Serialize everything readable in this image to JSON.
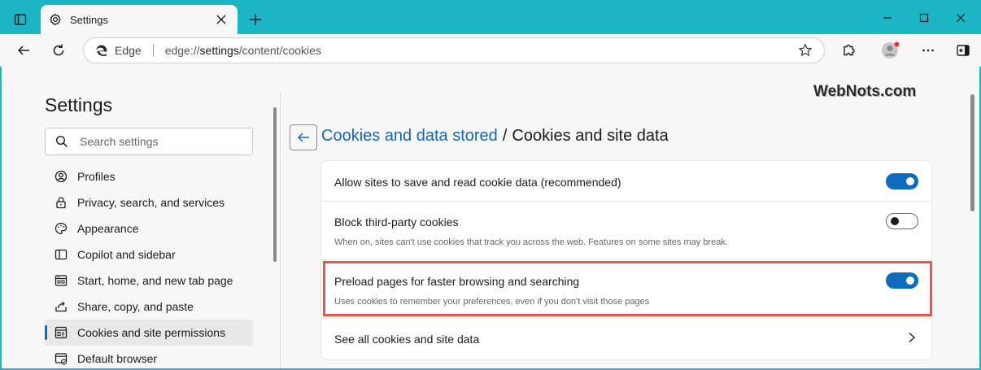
{
  "tab": {
    "title": "Settings"
  },
  "address": {
    "browser_label": "Edge",
    "url_prefix": "edge://",
    "url_bold": "settings",
    "url_suffix": "/content/cookies"
  },
  "watermark": "WebNots.com",
  "sidebar": {
    "title": "Settings",
    "search_placeholder": "Search settings",
    "items": [
      {
        "label": "Profiles",
        "icon": "profile-icon"
      },
      {
        "label": "Privacy, search, and services",
        "icon": "lock-icon"
      },
      {
        "label": "Appearance",
        "icon": "palette-icon"
      },
      {
        "label": "Copilot and sidebar",
        "icon": "sidebar-icon"
      },
      {
        "label": "Start, home, and new tab page",
        "icon": "home-page-icon"
      },
      {
        "label": "Share, copy, and paste",
        "icon": "share-icon"
      },
      {
        "label": "Cookies and site permissions",
        "icon": "cookies-icon",
        "active": true
      },
      {
        "label": "Default browser",
        "icon": "browser-icon"
      }
    ]
  },
  "main": {
    "breadcrumb_link": "Cookies and data stored",
    "breadcrumb_sep": "/",
    "breadcrumb_current": "Cookies and site data",
    "rows": [
      {
        "title": "Allow sites to save and read cookie data (recommended)",
        "toggle": "on"
      },
      {
        "title": "Block third-party cookies",
        "description": "When on, sites can't use cookies that track you across the web. Features on some sites may break.",
        "toggle": "off"
      },
      {
        "title": "Preload pages for faster browsing and searching",
        "description": "Uses cookies to remember your preferences, even if you don't visit those pages",
        "toggle": "on"
      },
      {
        "title": "See all cookies and site data"
      }
    ]
  },
  "colors": {
    "titlebar": "#1bb5c4",
    "accent": "#0f6cbd",
    "highlight": "#e5574b"
  }
}
